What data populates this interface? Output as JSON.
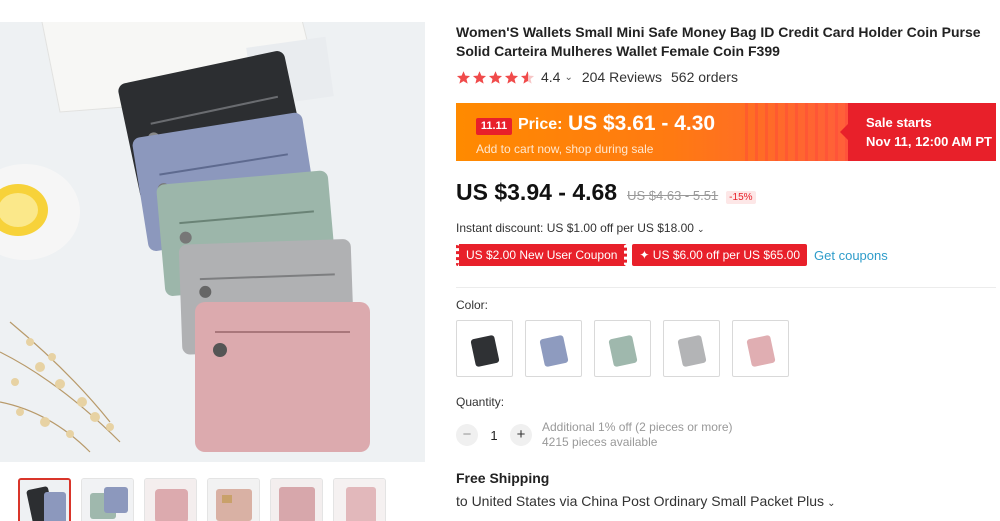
{
  "product": {
    "title": "Women'S Wallets Small Mini Safe Money Bag ID Credit Card Holder Coin Purse Solid Carteira Mulheres Wallet Female Coin F399",
    "rating": "4.4",
    "rating_caret": "⌄",
    "reviews": "204 Reviews",
    "orders": "562 orders"
  },
  "promo": {
    "badge": "11.11",
    "price_label": "Price:",
    "price": "US $3.61 - 4.30",
    "subtext": "Add to cart now, shop during sale",
    "sale_title": "Sale starts",
    "sale_time": "Nov 11, 12:00 AM PT"
  },
  "price": {
    "current": "US $3.94 - 4.68",
    "original": "US $4.63 - 5.51",
    "discount": "-15%"
  },
  "instant_discount": "Instant discount: US $1.00 off per US $18.00",
  "coupons": {
    "new_user": "US $2.00 New User Coupon",
    "store": "✦ US $6.00 off per US $65.00",
    "get": "Get coupons"
  },
  "color": {
    "label": "Color:",
    "options": [
      "black",
      "blue",
      "green",
      "gray",
      "pink"
    ],
    "swatch_colors": [
      "#2f3134",
      "#8e9bbf",
      "#9fb8ad",
      "#b3b4b6",
      "#e0aeb2"
    ]
  },
  "quantity": {
    "label": "Quantity:",
    "value": "1",
    "minus": "−",
    "plus": "+",
    "additional": "Additional 1% off (2 pieces or more)",
    "available": "4215 pieces available"
  },
  "shipping": {
    "title": "Free Shipping",
    "detail": "to United States via China Post Ordinary Small Packet Plus"
  },
  "theme": {
    "accent": "#e8202a",
    "promo_orange": "#ff8a00",
    "link": "#2e9cca"
  }
}
